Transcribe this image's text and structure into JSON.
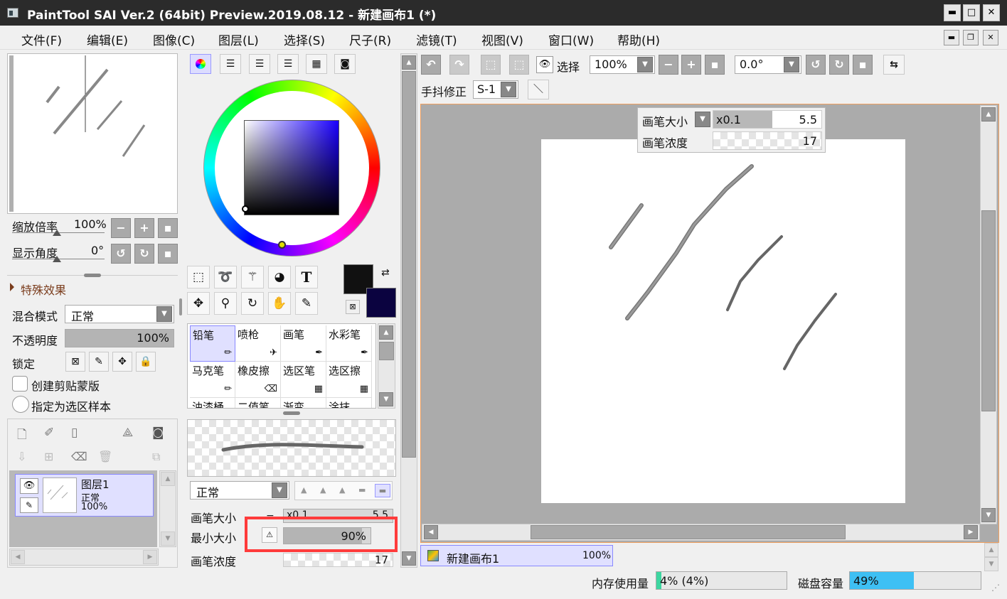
{
  "window": {
    "title": "PaintTool SAI Ver.2 (64bit) Preview.2019.08.12 - 新建画布1 (*)",
    "min": "▬",
    "max": "□",
    "close": "✕"
  },
  "menu": [
    "文件(F)",
    "编辑(E)",
    "图像(C)",
    "图层(L)",
    "选择(S)",
    "尺子(R)",
    "滤镜(T)",
    "视图(V)",
    "窗口(W)",
    "帮助(H)"
  ],
  "navigator": {
    "zoom_label": "缩放倍率",
    "zoom_value": "100%",
    "angle_label": "显示角度",
    "angle_value": "0°"
  },
  "special_effects": "特殊效果",
  "layer_props": {
    "blend_label": "混合模式",
    "blend_value": "正常",
    "opacity_label": "不透明度",
    "opacity_value": "100%",
    "opacity_fraction": 1.0,
    "lock_label": "锁定",
    "clip_label": "创建剪贴蒙版",
    "sample_label": "指定为选区样本"
  },
  "layers": [
    {
      "name": "图层1",
      "mode": "正常",
      "opacity": "100%"
    }
  ],
  "tools": {
    "text_tool": "T"
  },
  "brushes": [
    "铅笔",
    "喷枪",
    "画笔",
    "水彩笔",
    "马克笔",
    "橡皮擦",
    "选区笔",
    "选区擦",
    "油漆桶",
    "二值笔",
    "渐变",
    "涂抹"
  ],
  "brush_settings": {
    "blend_mode": "正常",
    "size_label": "画笔大小",
    "size_mult": "x0.1",
    "size_value": "5.5",
    "min_size_label": "最小大小",
    "min_size_value": "90%",
    "min_size_fraction": 0.9,
    "density_label": "画笔浓度",
    "density_value": "17"
  },
  "canvas_toolbar": {
    "select_label": "选择",
    "zoom": "100%",
    "angle": "0.0°",
    "stabilizer_label": "手抖修正",
    "stabilizer_value": "S-1"
  },
  "canvas_popup": {
    "size_label": "画笔大小",
    "size_mult": "x0.1",
    "size_value": "5.5",
    "density_label": "画笔浓度",
    "density_value": "17"
  },
  "canvas_tab": {
    "name": "新建画布1",
    "zoom": "100%"
  },
  "status": {
    "memory_label": "内存使用量",
    "memory_value": "4% (4%)",
    "memory_fraction": 0.04,
    "disk_label": "磁盘容量",
    "disk_value": "49%",
    "disk_fraction": 0.49
  },
  "colors": {
    "foreground": "#111111",
    "background": "#0b0340",
    "accent": "#ff3b3b",
    "selection": "#e0e0ff",
    "memory_bar": "#3dd6a0",
    "disk_bar": "#3ec0f4"
  }
}
